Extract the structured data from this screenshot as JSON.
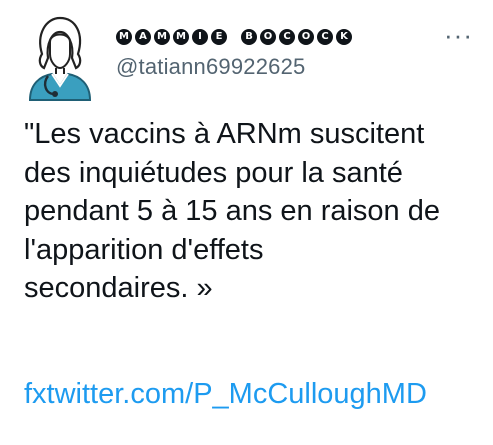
{
  "author": {
    "display_name_letters": [
      "M",
      "A",
      "M",
      "M",
      "I",
      "E",
      " ",
      "B",
      "O",
      "C",
      "O",
      "C",
      "K"
    ],
    "handle": "@tatiann69922625",
    "avatar_icon": "nurse-avatar-icon",
    "more_label": "···"
  },
  "tweet": {
    "text": "\"Les vaccins à ARNm suscitent\ndes inquiétudes pour la santé\npendant 5 à 15 ans en raison de\nl'apparition d'effets\nsecondaires. »",
    "link": "fxtwitter.com/P_McCulloughMD"
  },
  "colors": {
    "text": "#0f1419",
    "secondary": "#536471",
    "link": "#1d9bf0",
    "avatar_teal": "#3a9fbf"
  }
}
